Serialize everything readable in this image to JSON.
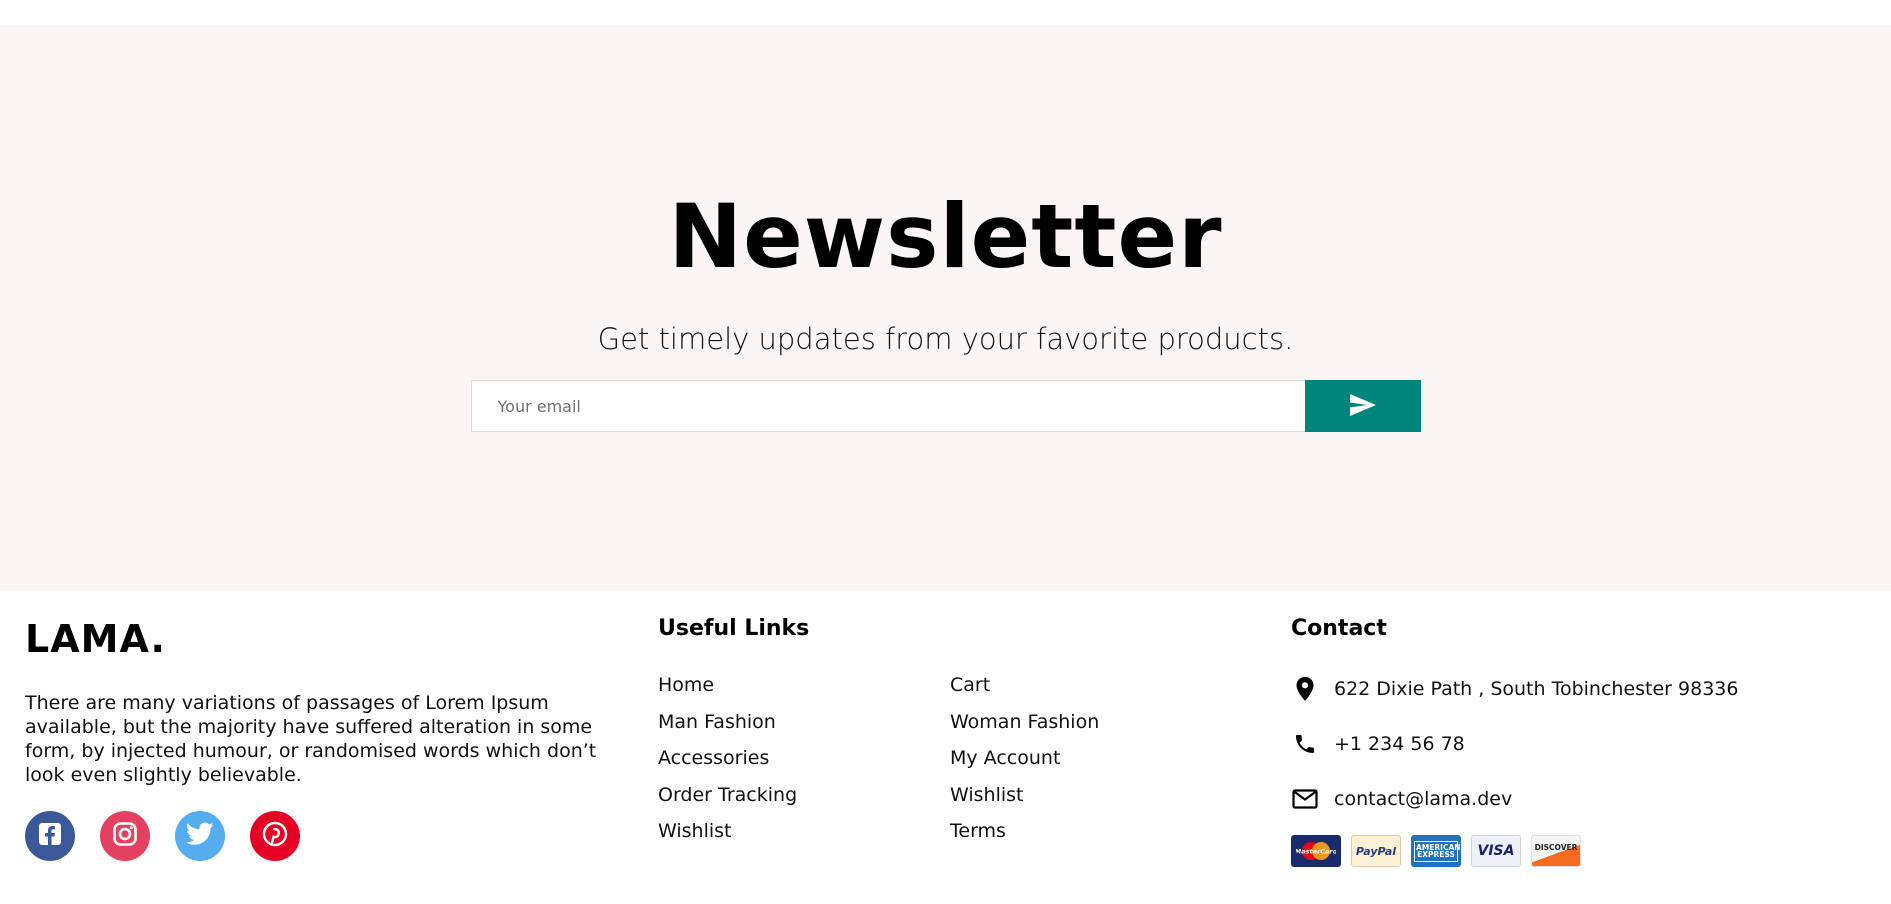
{
  "newsletter": {
    "title": "Newsletter",
    "subtitle": "Get timely updates from your favorite products.",
    "email_placeholder": "Your email",
    "send_icon": "send-icon"
  },
  "footer": {
    "logo": "LAMA.",
    "description": "There are many variations of passages of Lorem Ipsum available, but the majority have suffered alteration in some form, by injected humour, or randomised words which don’t look even slightly believable.",
    "socials": [
      {
        "icon": "facebook-icon",
        "color": "#3b5999"
      },
      {
        "icon": "instagram-icon",
        "color": "#e4405f"
      },
      {
        "icon": "twitter-icon",
        "color": "#55acee"
      },
      {
        "icon": "pinterest-icon",
        "color": "#e60023"
      }
    ],
    "useful_links": {
      "title": "Useful Links",
      "items": [
        "Home",
        "Cart",
        "Man Fashion",
        "Woman Fashion",
        "Accessories",
        "My Account",
        "Order Tracking",
        "Wishlist",
        "Wishlist",
        "Terms"
      ]
    },
    "contact": {
      "title": "Contact",
      "address": "622 Dixie Path , South Tobinchester 98336",
      "phone": "+1 234 56 78",
      "email": "contact@lama.dev"
    },
    "payments": [
      {
        "icon": "mastercard-icon",
        "label": "MasterCard"
      },
      {
        "icon": "paypal-icon",
        "label": "PayPal"
      },
      {
        "icon": "amex-icon",
        "label": "AMERICAN EXPRESS"
      },
      {
        "icon": "visa-icon",
        "label": "VISA"
      },
      {
        "icon": "discover-icon",
        "label": "DISCOVER"
      }
    ]
  },
  "colors": {
    "newsletter_bg": "#fbf5f5",
    "accent": "#00857a"
  }
}
